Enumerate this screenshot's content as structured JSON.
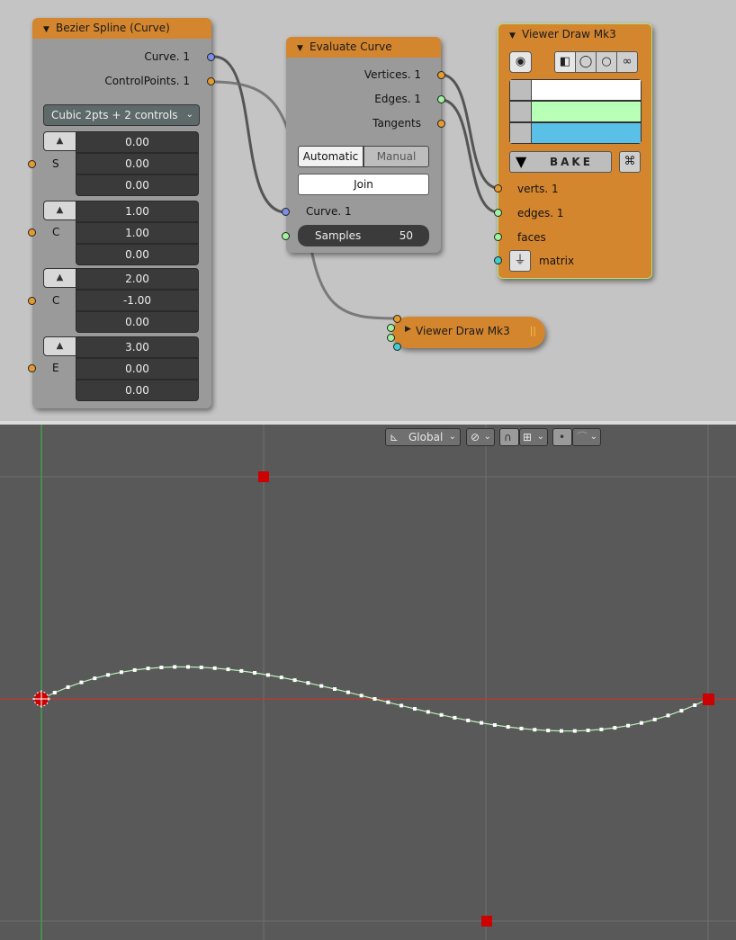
{
  "nodes": {
    "bezier": {
      "title": "Bezier Spline (Curve)",
      "outputs": [
        "Curve. 1",
        "ControlPoints. 1"
      ],
      "mode": "Cubic 2pts + 2 controls",
      "points": [
        {
          "label": "S",
          "values": [
            "0.00",
            "0.00",
            "0.00"
          ]
        },
        {
          "label": "C",
          "values": [
            "1.00",
            "1.00",
            "0.00"
          ]
        },
        {
          "label": "C",
          "values": [
            "2.00",
            "-1.00",
            "0.00"
          ]
        },
        {
          "label": "E",
          "values": [
            "3.00",
            "0.00",
            "0.00"
          ]
        }
      ]
    },
    "evaluate": {
      "title": "Evaluate Curve",
      "outputs": [
        "Vertices. 1",
        "Edges. 1",
        "Tangents"
      ],
      "mode_automatic": "Automatic",
      "mode_manual": "Manual",
      "join": "Join",
      "input_curve": "Curve. 1",
      "samples_label": "Samples",
      "samples_value": "50"
    },
    "viewer_expanded": {
      "title": "Viewer Draw Mk3",
      "colors": [
        "#ffffff",
        "#b8ffb8",
        "#5bc0e8"
      ],
      "bake": "BAKE",
      "inputs": [
        "verts. 1",
        "edges. 1",
        "faces",
        "matrix"
      ]
    },
    "viewer_collapsed": {
      "title": "Viewer Draw Mk3",
      "pause": "||"
    }
  },
  "viewport": {
    "orientation": "Global"
  },
  "colors": {
    "node_body": "#9a9a9a",
    "node_header": "#d4862f",
    "viewer_body": "#d4862f",
    "editor_bg": "#c4c4c4",
    "viewport_bg": "#595959",
    "curve_color": "#b8f0b8",
    "control_point": "#cc0000",
    "x_axis": "#c0392b",
    "y_axis": "#3cb043"
  }
}
